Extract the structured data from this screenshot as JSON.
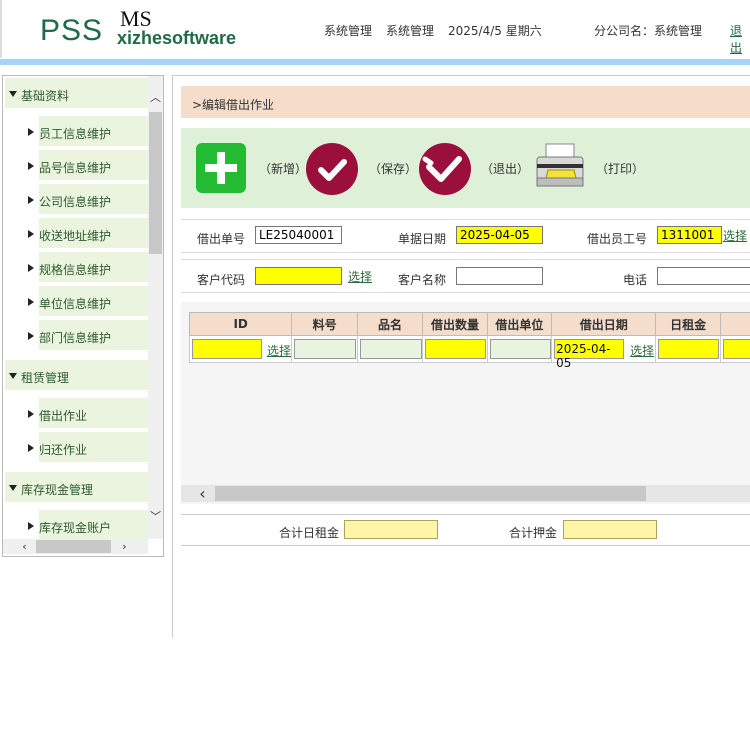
{
  "header": {
    "logo_pss": "PSS",
    "logo_ms": "MS",
    "logo_xz": "xizhesoftware",
    "system1": "系统管理",
    "system2": "系统管理",
    "date": "2025/4/5 星期六",
    "branch_label": "分公司名：",
    "branch_value": "系统管理",
    "logout": "退出"
  },
  "nav": {
    "groups": [
      {
        "label": "基础资料",
        "items": [
          "员工信息维护",
          "品号信息维护",
          "公司信息维护",
          "收送地址维护",
          "规格信息维护",
          "单位信息维护",
          "部门信息维护"
        ]
      },
      {
        "label": "租赁管理",
        "items": [
          "借出作业",
          "归还作业"
        ]
      },
      {
        "label": "库存现金管理",
        "items": [
          "库存现金账户"
        ]
      }
    ]
  },
  "breadcrumb": ">编辑借出作业",
  "toolbar": {
    "add_label": "（新增）",
    "save_label": "（保存）",
    "exit_label": "（退出）",
    "print_label": "（打印）"
  },
  "form": {
    "order_no_label": "借出单号",
    "order_no_value": "LE25040001",
    "doc_date_label": "单据日期",
    "doc_date_value": "2025-04-05",
    "staff_label": "借出员工号",
    "staff_value": "1311001",
    "select_label": "选择",
    "customer_code_label": "客户代码",
    "customer_code_value": "",
    "customer_name_label": "客户名称",
    "customer_name_value": "",
    "phone_label": "电话",
    "phone_value": ""
  },
  "grid": {
    "columns": [
      "ID",
      "料号",
      "品名",
      "借出数量",
      "借出单位",
      "借出日期",
      "日租金"
    ],
    "row": {
      "id": "",
      "select_label": "选择",
      "date": "2025-04-05",
      "date_select": "选择"
    }
  },
  "totals": {
    "daily_rent_label": "合计日租金",
    "daily_rent_value": "",
    "deposit_label": "合计押金",
    "deposit_value": ""
  },
  "colors": {
    "brand_green": "#1f6b46",
    "nav_bg": "#eaf4de",
    "toolbar_bg": "#dff0d8",
    "breadcrumb_bg": "#f5ddcb",
    "highlight_yellow": "#ffff00",
    "button_wine": "#9a0f3c",
    "button_green": "#22bb33"
  },
  "icons": [
    "plus-icon",
    "check-icon",
    "exit-check-icon",
    "printer-icon",
    "triangle-down-icon",
    "triangle-right-icon"
  ]
}
